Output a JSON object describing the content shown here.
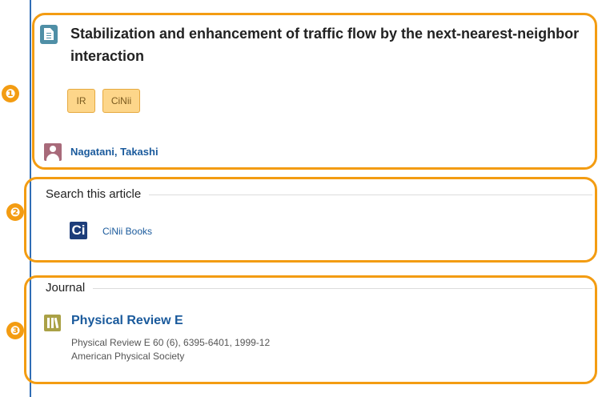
{
  "article": {
    "title": "Stabilization and enhancement of traffic flow by the next-nearest-neighbor interaction",
    "tags": [
      "IR",
      "CiNii"
    ],
    "author": "Nagatani, Takashi"
  },
  "search_section": {
    "heading": "Search this article",
    "links": [
      {
        "label": "CiNii Books",
        "icon": "Ci"
      }
    ]
  },
  "journal_section": {
    "heading": "Journal",
    "title": "Physical Review E",
    "citation": "Physical Review E 60 (6), 6395-6401, 1999-12",
    "publisher": "American Physical Society"
  },
  "annotations": [
    "❶",
    "❷",
    "❸"
  ],
  "colors": {
    "annotation_orange": "#f39c12",
    "link_blue": "#1a5a9c",
    "tag_bg": "#fdd68a"
  }
}
